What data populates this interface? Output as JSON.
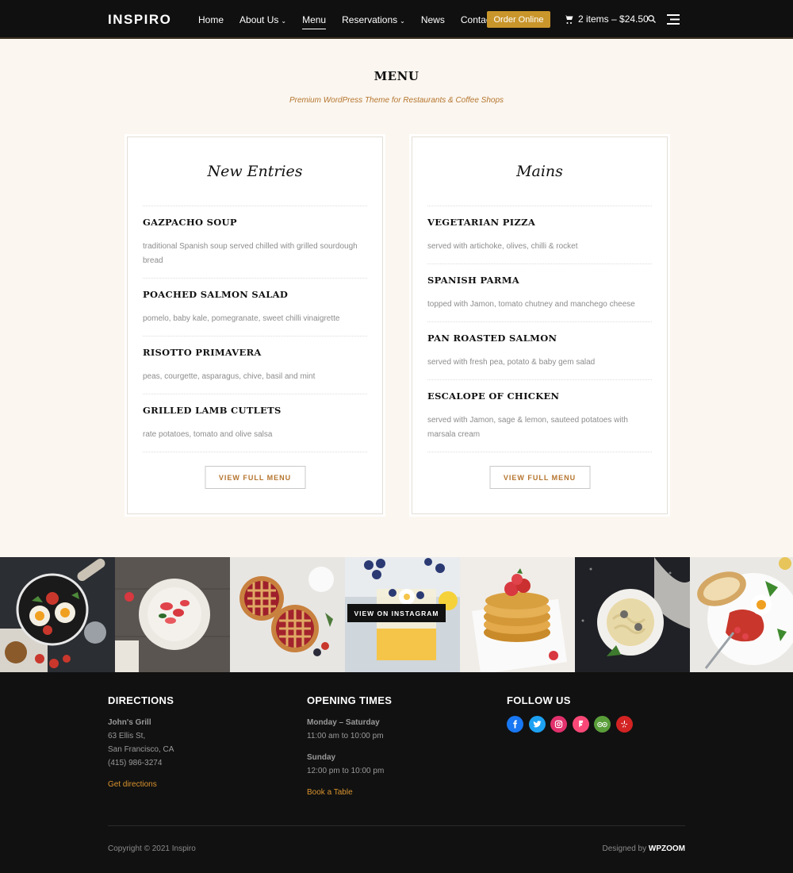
{
  "header": {
    "logo": "INSPIRO",
    "nav": [
      {
        "label": "Home",
        "has_dropdown": false,
        "active": false
      },
      {
        "label": "About Us",
        "has_dropdown": true,
        "active": false
      },
      {
        "label": "Menu",
        "has_dropdown": false,
        "active": true
      },
      {
        "label": "Reservations",
        "has_dropdown": true,
        "active": false
      },
      {
        "label": "News",
        "has_dropdown": false,
        "active": false
      },
      {
        "label": "Contact",
        "has_dropdown": false,
        "active": false
      }
    ],
    "order_button": "Order Online",
    "cart": "2 items – $24.50",
    "accent_color": "#c9962b"
  },
  "menu": {
    "title": "MENU",
    "subtitle": "Premium WordPress Theme for Restaurants & Coffee Shops",
    "cards": [
      {
        "title": "New Entries",
        "items": [
          {
            "name": "GAZPACHO SOUP",
            "desc": "traditional Spanish soup served chilled with grilled sourdough bread"
          },
          {
            "name": "POACHED SALMON SALAD",
            "desc": "pomelo, baby kale, pomegranate, sweet chilli vinaigrette"
          },
          {
            "name": "RISOTTO PRIMAVERA",
            "desc": "peas, courgette, asparagus, chive, basil and mint"
          },
          {
            "name": "GRILLED LAMB CUTLETS",
            "desc": "rate potatoes, tomato and olive salsa"
          }
        ],
        "button": "VIEW FULL MENU"
      },
      {
        "title": "Mains",
        "items": [
          {
            "name": "VEGETARIAN PIZZA",
            "desc": "served with artichoke, olives, chilli & rocket"
          },
          {
            "name": "SPANISH PARMA",
            "desc": "topped with Jamon, tomato chutney and manchego cheese"
          },
          {
            "name": "PAN ROASTED SALMON",
            "desc": "served with fresh pea, potato & baby gem salad"
          },
          {
            "name": "ESCALOPE OF CHICKEN",
            "desc": "served with Jamon, sage & lemon, sauteed potatoes with marsala cream"
          }
        ],
        "button": "VIEW FULL MENU"
      }
    ]
  },
  "instagram": {
    "button": "VIEW ON INSTAGRAM",
    "photos": [
      "eggs-in-pan",
      "strawberries-plate",
      "cherry-pies",
      "blueberry-parfait",
      "pancakes-strawberries",
      "pasta-bowl",
      "bacon-eggs-breakfast"
    ]
  },
  "footer": {
    "directions": {
      "heading": "DIRECTIONS",
      "name": "John's Grill",
      "address1": "63 Ellis St,",
      "address2": "San Francisco, CA",
      "phone": "(415) 986-3274",
      "link": "Get directions"
    },
    "hours": {
      "heading": "OPENING TIMES",
      "day1": "Monday – Saturday",
      "time1": "11:00 am to 10:00 pm",
      "day2": "Sunday",
      "time2": "12:00 pm to 10:00 pm",
      "link": "Book a Table"
    },
    "follow": {
      "heading": "FOLLOW US",
      "icons": [
        {
          "name": "facebook-icon",
          "color": "#1877f2"
        },
        {
          "name": "twitter-icon",
          "color": "#1da1f2"
        },
        {
          "name": "instagram-icon",
          "color": "#e1306c"
        },
        {
          "name": "foursquare-icon",
          "color": "#f94877"
        },
        {
          "name": "tripadvisor-icon",
          "color": "#5a9e3a"
        },
        {
          "name": "yelp-icon",
          "color": "#d32323"
        }
      ]
    },
    "copyright": "Copyright © 2021 Inspiro",
    "designed_prefix": "Designed by",
    "designed_brand": "WPZOOM"
  }
}
